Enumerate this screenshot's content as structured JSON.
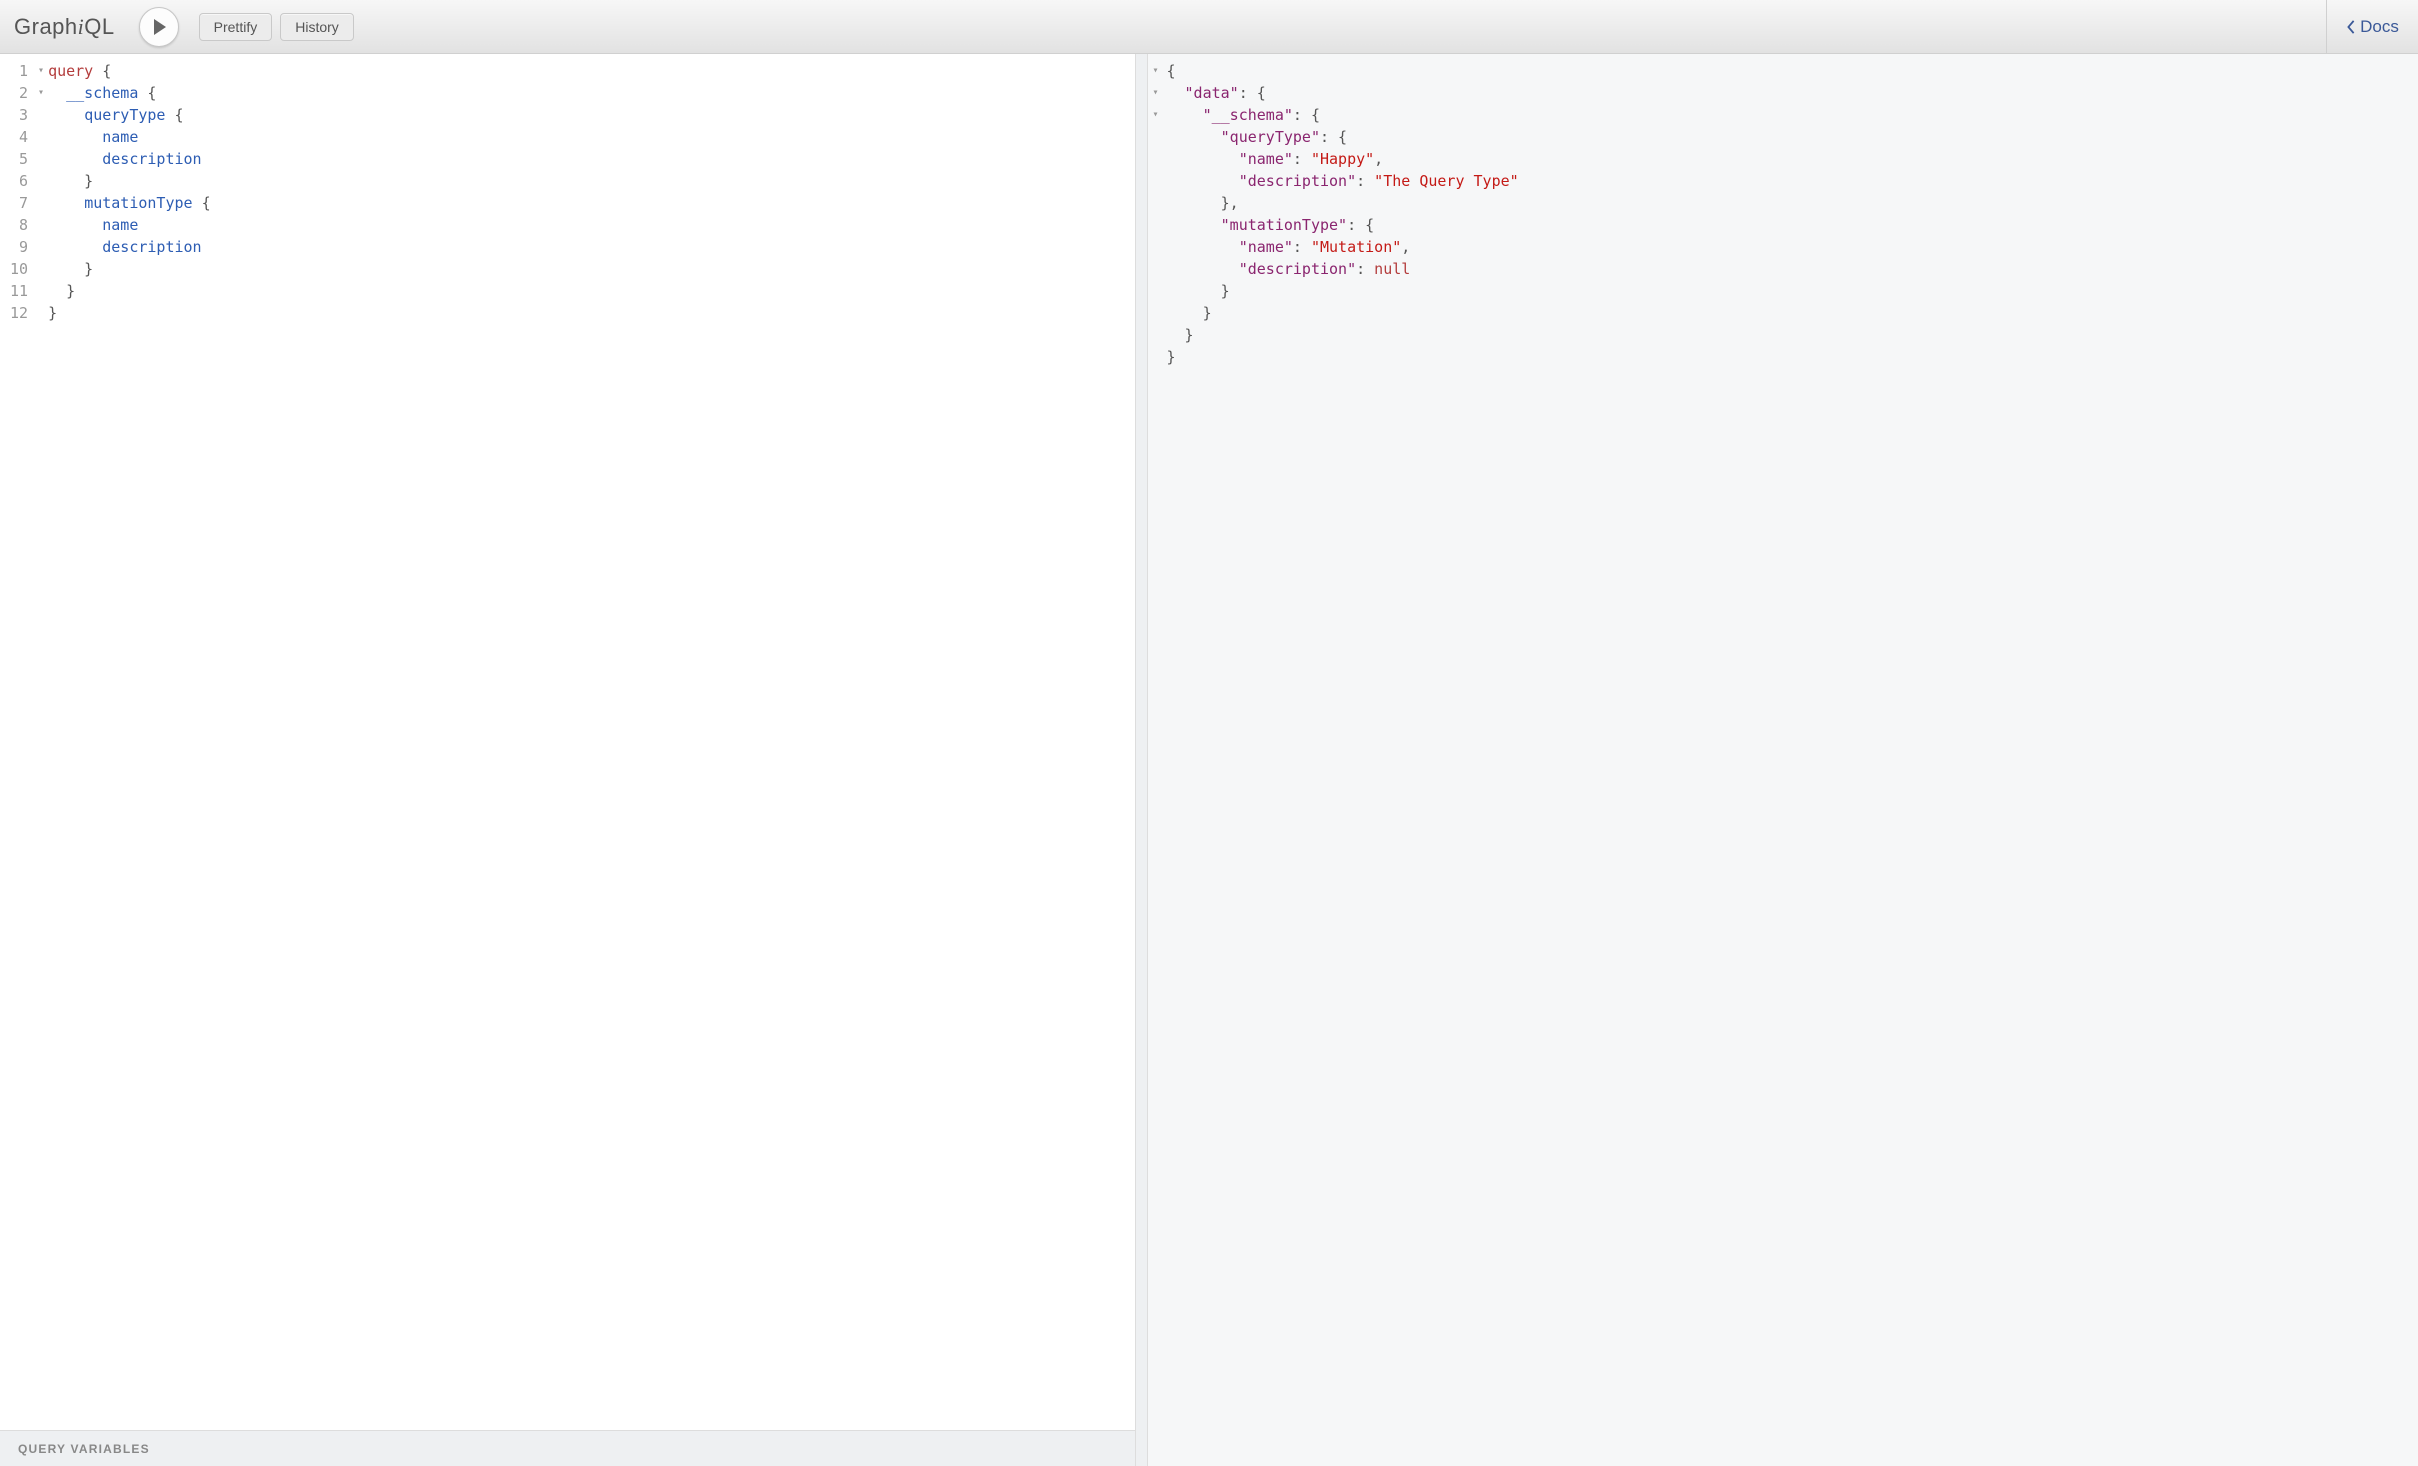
{
  "toolbar": {
    "logo_parts": {
      "a": "Graph",
      "b": "i",
      "c": "QL"
    },
    "prettify_label": "Prettify",
    "history_label": "History",
    "docs_label": "Docs"
  },
  "editor": {
    "fold_markers": [
      "▾",
      "▾",
      "",
      "",
      "",
      "",
      "",
      "",
      "",
      "",
      "",
      ""
    ],
    "line_numbers": [
      "1",
      "2",
      "3",
      "4",
      "5",
      "6",
      "7",
      "8",
      "9",
      "10",
      "11",
      "12"
    ],
    "lines": [
      [
        {
          "t": "query",
          "c": "kw"
        },
        {
          "t": " {",
          "c": "punc"
        }
      ],
      [
        {
          "t": "  ",
          "c": ""
        },
        {
          "t": "__schema",
          "c": "fld"
        },
        {
          "t": " {",
          "c": "punc"
        }
      ],
      [
        {
          "t": "    ",
          "c": ""
        },
        {
          "t": "queryType",
          "c": "fld"
        },
        {
          "t": " {",
          "c": "punc"
        }
      ],
      [
        {
          "t": "      ",
          "c": ""
        },
        {
          "t": "name",
          "c": "fld"
        }
      ],
      [
        {
          "t": "      ",
          "c": ""
        },
        {
          "t": "description",
          "c": "fld"
        }
      ],
      [
        {
          "t": "    }",
          "c": "punc"
        }
      ],
      [
        {
          "t": "    ",
          "c": ""
        },
        {
          "t": "mutationType",
          "c": "fld"
        },
        {
          "t": " {",
          "c": "punc"
        }
      ],
      [
        {
          "t": "      ",
          "c": ""
        },
        {
          "t": "name",
          "c": "fld"
        }
      ],
      [
        {
          "t": "      ",
          "c": ""
        },
        {
          "t": "description",
          "c": "fld"
        }
      ],
      [
        {
          "t": "    }",
          "c": "punc"
        }
      ],
      [
        {
          "t": "  }",
          "c": "punc"
        }
      ],
      [
        {
          "t": "}",
          "c": "punc"
        }
      ]
    ],
    "variables_label": "Query Variables"
  },
  "result": {
    "fold_markers": [
      "▾",
      "▾",
      "▾",
      "",
      "",
      "",
      "",
      "",
      "",
      "",
      "",
      "",
      "",
      ""
    ],
    "lines": [
      [
        {
          "t": "{",
          "c": "jpunc"
        }
      ],
      [
        {
          "t": "  ",
          "c": ""
        },
        {
          "t": "\"data\"",
          "c": "jkey"
        },
        {
          "t": ": {",
          "c": "jpunc"
        }
      ],
      [
        {
          "t": "    ",
          "c": ""
        },
        {
          "t": "\"__schema\"",
          "c": "jkey"
        },
        {
          "t": ": {",
          "c": "jpunc"
        }
      ],
      [
        {
          "t": "      ",
          "c": ""
        },
        {
          "t": "\"queryType\"",
          "c": "jkey"
        },
        {
          "t": ": {",
          "c": "jpunc"
        }
      ],
      [
        {
          "t": "        ",
          "c": ""
        },
        {
          "t": "\"name\"",
          "c": "jkey"
        },
        {
          "t": ": ",
          "c": "jpunc"
        },
        {
          "t": "\"Happy\"",
          "c": "jstr"
        },
        {
          "t": ",",
          "c": "jpunc"
        }
      ],
      [
        {
          "t": "        ",
          "c": ""
        },
        {
          "t": "\"description\"",
          "c": "jkey"
        },
        {
          "t": ": ",
          "c": "jpunc"
        },
        {
          "t": "\"The Query Type\"",
          "c": "jstr"
        }
      ],
      [
        {
          "t": "      },",
          "c": "jpunc"
        }
      ],
      [
        {
          "t": "      ",
          "c": ""
        },
        {
          "t": "\"mutationType\"",
          "c": "jkey"
        },
        {
          "t": ": {",
          "c": "jpunc"
        }
      ],
      [
        {
          "t": "        ",
          "c": ""
        },
        {
          "t": "\"name\"",
          "c": "jkey"
        },
        {
          "t": ": ",
          "c": "jpunc"
        },
        {
          "t": "\"Mutation\"",
          "c": "jstr"
        },
        {
          "t": ",",
          "c": "jpunc"
        }
      ],
      [
        {
          "t": "        ",
          "c": ""
        },
        {
          "t": "\"description\"",
          "c": "jkey"
        },
        {
          "t": ": ",
          "c": "jpunc"
        },
        {
          "t": "null",
          "c": "jnull"
        }
      ],
      [
        {
          "t": "      }",
          "c": "jpunc"
        }
      ],
      [
        {
          "t": "    }",
          "c": "jpunc"
        }
      ],
      [
        {
          "t": "  }",
          "c": "jpunc"
        }
      ],
      [
        {
          "t": "}",
          "c": "jpunc"
        }
      ]
    ]
  }
}
